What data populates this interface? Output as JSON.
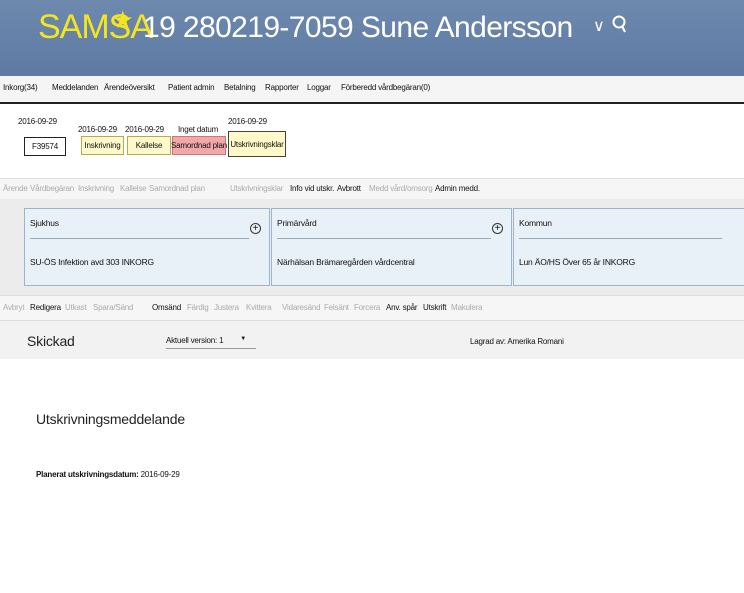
{
  "header": {
    "logo": "SAMSA",
    "patient": "19 280219-7059 Sune Andersson"
  },
  "menu": [
    "Inkorg(34)",
    "Meddelanden",
    "Ärendeöversikt",
    "Patient admin",
    "Betalning",
    "Rapporter",
    "Loggar",
    "Förberedd vårdbegäran(0)"
  ],
  "timeline": {
    "dates": [
      "2016-09-29",
      "2016-09-29",
      "2016-09-29",
      "Inget datum",
      "2016-09-29"
    ],
    "case_id": "F39574",
    "steps": [
      "Inskrivning",
      "Kallelse",
      "Samordnad plan",
      "Utskrivningsklar"
    ]
  },
  "actions": [
    "Ärende",
    "Vårdbegäran",
    "Inskrivning",
    "Kallelse",
    "Samordnad plan",
    "Utskrivningsklar",
    "Info vid utskr.",
    "Avbrott",
    "Medd vård/omsorg",
    "Admin medd."
  ],
  "panels": [
    {
      "title": "Sjukhus",
      "value": "SU-ÖS Infektion avd 303 INKORG"
    },
    {
      "title": "Primärvård",
      "value": "Närhälsan Brämaregården vårdcentral"
    },
    {
      "title": "Kommun",
      "value": "Lun ÄO/HS Över 65 år INKORG"
    }
  ],
  "edit_actions": [
    "Avbryt",
    "Redigera",
    "Utkast",
    "Spara/Sänd",
    "Omsänd",
    "Färdig",
    "Justera",
    "Kvittera",
    "Vidaresänd",
    "Felsänt",
    "Forcera",
    "Anv. spår",
    "Utskrift",
    "Makulera"
  ],
  "status": {
    "state": "Skickad",
    "version": "Aktuell version: 1",
    "saved_by": "Lagrad av: Amerika Romani"
  },
  "document": {
    "title": "Utskrivningsmeddelande",
    "plan_label": "Planerat utskrivningsdatum:",
    "plan_value": "2016-09-29"
  },
  "colors": {
    "header_bg": "#5f7ca6",
    "logo": "#f4e51f",
    "step_yellow": "#fff8c8",
    "step_red": "#f2a8a8",
    "panel_bg": "#e8f1f8"
  }
}
